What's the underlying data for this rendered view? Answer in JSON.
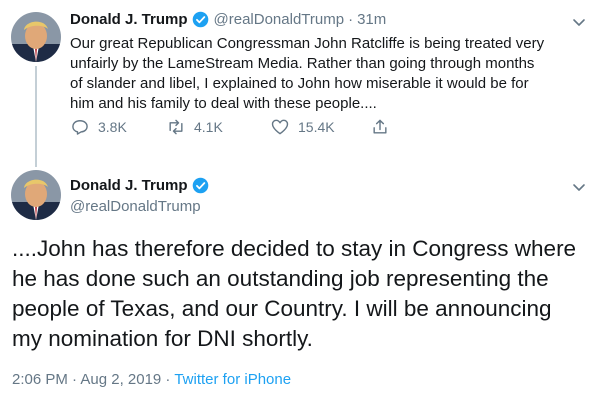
{
  "tweet1": {
    "name": "Donald J. Trump",
    "handle": "@realDonaldTrump",
    "separator": "·",
    "time": "31m",
    "text": "Our great Republican Congressman John Ratcliffe is being treated very unfairly by the LameStream Media. Rather than going through months of slander and libel, I explained to John how miserable it would be for him and his family to deal with these people....",
    "replies": "3.8K",
    "retweets": "4.1K",
    "likes": "15.4K"
  },
  "tweet2": {
    "name": "Donald J. Trump",
    "handle": "@realDonaldTrump",
    "text": "....John has therefore decided to stay in Congress where he has done such an outstanding job representing the people of Texas, and our Country. I will be announcing my nomination for DNI shortly.",
    "timestamp": "2:06 PM · Aug 2, 2019 ·",
    "source": "Twitter for iPhone"
  },
  "icons": {
    "avatar": "avatar-photo",
    "verified": "verified-badge-icon",
    "menu": "chevron-down-icon",
    "reply": "reply-icon",
    "retweet": "retweet-icon",
    "like": "heart-icon",
    "share": "share-icon"
  },
  "colors": {
    "text": "#14171a",
    "secondary": "#657786",
    "accent": "#1da1f2",
    "thread_line": "#c4cfd6"
  }
}
